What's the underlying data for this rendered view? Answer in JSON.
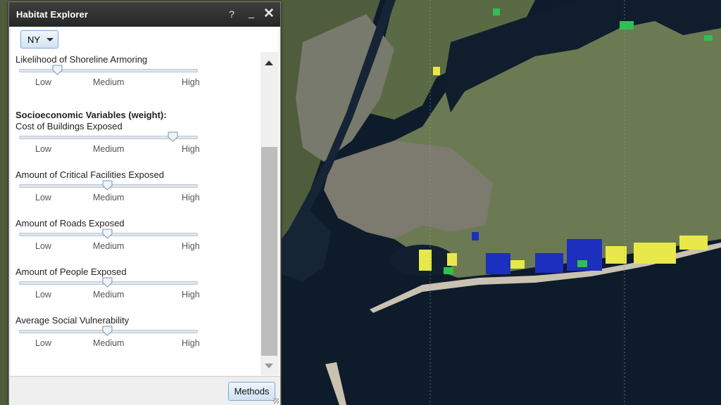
{
  "window": {
    "title": "Habitat Explorer",
    "help_label": "?",
    "minimize_label": "_",
    "close_label": "✕"
  },
  "state_selector": {
    "value": "NY"
  },
  "sliders": [
    {
      "label": "Likelihood of Shoreline Armoring",
      "level": "Low",
      "position": 0.22
    },
    {
      "label": "Cost of Buildings Exposed",
      "level": "High",
      "position": 0.87
    },
    {
      "label": "Amount of Critical Facilities Exposed",
      "level": "Medium",
      "position": 0.5
    },
    {
      "label": "Amount of Roads Exposed",
      "level": "Medium",
      "position": 0.5
    },
    {
      "label": "Amount of People Exposed",
      "level": "Medium",
      "position": 0.5
    },
    {
      "label": "Average Social Vulnerability",
      "level": "Medium",
      "position": 0.5
    }
  ],
  "section_heading": "Socioeconomic Variables (weight):",
  "ticks": {
    "low": "Low",
    "medium": "Medium",
    "high": "High"
  },
  "footer": {
    "methods_label": "Methods"
  },
  "colors": {
    "water": "#0e1b2b",
    "land": "#5c6b45",
    "urban": "#7a7a70",
    "habitat_yellow": "#e8e84a",
    "habitat_blue": "#1c2fbf",
    "habitat_green": "#2fbf55"
  }
}
